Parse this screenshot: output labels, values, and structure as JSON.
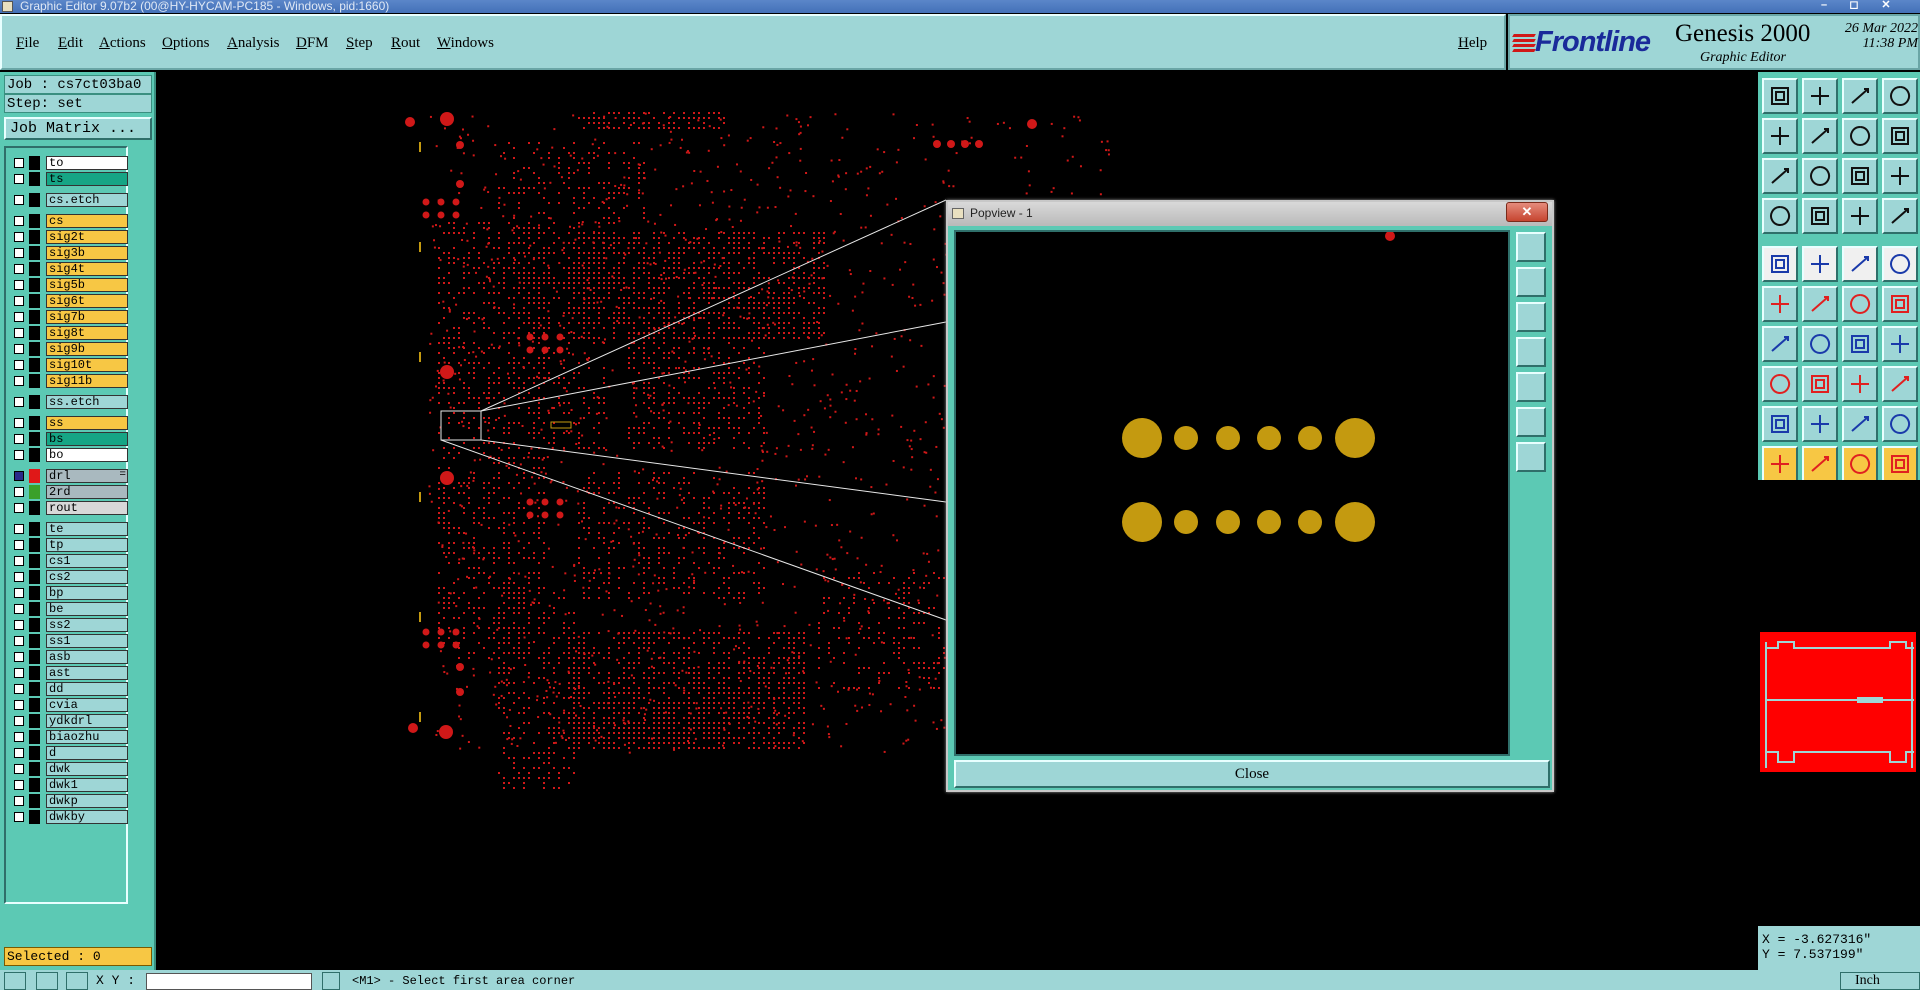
{
  "window": {
    "title": "Graphic Editor 9.07b2 (00@HY-HYCAM-PC185 - Windows, pid:1660)",
    "controls": [
      "–",
      "◻",
      "✕"
    ]
  },
  "menu": {
    "items": [
      "File",
      "Edit",
      "Actions",
      "Options",
      "Analysis",
      "DFM",
      "Step",
      "Rout",
      "Windows"
    ],
    "help": "Help"
  },
  "logo": {
    "brand": "Frontline",
    "product": "Genesis 2000",
    "subtitle": "Graphic Editor",
    "date": "26 Mar 2022",
    "time": "11:38 PM"
  },
  "job": {
    "job_label": "Job : cs7ct03ba0",
    "step_label": "Step: set",
    "job_matrix": "Job Matrix ..."
  },
  "layers": [
    {
      "name": "to",
      "color": "#ffffff",
      "swatch": "#000000"
    },
    {
      "name": "ts",
      "color": "#16a585",
      "swatch": "#000000"
    },
    {
      "name": "cs.etch",
      "color": "#9ed6d6",
      "swatch": "#000000",
      "gap": true
    },
    {
      "name": "cs",
      "color": "#f7c744",
      "swatch": "#000000",
      "gap": true
    },
    {
      "name": "sig2t",
      "color": "#f7c744",
      "swatch": "#000000"
    },
    {
      "name": "sig3b",
      "color": "#f7c744",
      "swatch": "#000000"
    },
    {
      "name": "sig4t",
      "color": "#f7c744",
      "swatch": "#000000"
    },
    {
      "name": "sig5b",
      "color": "#f7c744",
      "swatch": "#000000"
    },
    {
      "name": "sig6t",
      "color": "#f7c744",
      "swatch": "#000000"
    },
    {
      "name": "sig7b",
      "color": "#f7c744",
      "swatch": "#000000"
    },
    {
      "name": "sig8t",
      "color": "#f7c744",
      "swatch": "#000000"
    },
    {
      "name": "sig9b",
      "color": "#f7c744",
      "swatch": "#000000"
    },
    {
      "name": "sig10t",
      "color": "#f7c744",
      "swatch": "#000000"
    },
    {
      "name": "sig11b",
      "color": "#f7c744",
      "swatch": "#000000"
    },
    {
      "name": "ss.etch",
      "color": "#9ed6d6",
      "swatch": "#000000",
      "gap": true
    },
    {
      "name": "ss",
      "color": "#f7c744",
      "swatch": "#000000",
      "gap": true
    },
    {
      "name": "bs",
      "color": "#16a585",
      "swatch": "#000000"
    },
    {
      "name": "bo",
      "color": "#ffffff",
      "swatch": "#000000"
    },
    {
      "name": "drl",
      "color": "#a9b9bf",
      "swatch": "#e01818",
      "gap": true,
      "active": true,
      "marker": "="
    },
    {
      "name": "2rd",
      "color": "#a9b9bf",
      "swatch": "#3aa02a"
    },
    {
      "name": "rout",
      "color": "#d8d8d8",
      "swatch": "#000000"
    },
    {
      "name": "te",
      "color": "#9ed6d6",
      "swatch": "#000000",
      "gap": true
    },
    {
      "name": "tp",
      "color": "#9ed6d6",
      "swatch": "#000000"
    },
    {
      "name": "cs1",
      "color": "#9ed6d6",
      "swatch": "#000000"
    },
    {
      "name": "cs2",
      "color": "#9ed6d6",
      "swatch": "#000000"
    },
    {
      "name": "bp",
      "color": "#9ed6d6",
      "swatch": "#000000"
    },
    {
      "name": "be",
      "color": "#9ed6d6",
      "swatch": "#000000"
    },
    {
      "name": "ss2",
      "color": "#9ed6d6",
      "swatch": "#000000"
    },
    {
      "name": "ss1",
      "color": "#9ed6d6",
      "swatch": "#000000"
    },
    {
      "name": "asb",
      "color": "#9ed6d6",
      "swatch": "#000000"
    },
    {
      "name": "ast",
      "color": "#9ed6d6",
      "swatch": "#000000"
    },
    {
      "name": "dd",
      "color": "#9ed6d6",
      "swatch": "#000000"
    },
    {
      "name": "cvia",
      "color": "#9ed6d6",
      "swatch": "#000000"
    },
    {
      "name": "ydkdrl",
      "color": "#9ed6d6",
      "swatch": "#000000"
    },
    {
      "name": "biaozhu",
      "color": "#9ed6d6",
      "swatch": "#000000"
    },
    {
      "name": "d",
      "color": "#9ed6d6",
      "swatch": "#000000"
    },
    {
      "name": "dwk",
      "color": "#9ed6d6",
      "swatch": "#000000"
    },
    {
      "name": "dwk1",
      "color": "#9ed6d6",
      "swatch": "#000000"
    },
    {
      "name": "dwkp",
      "color": "#9ed6d6",
      "swatch": "#000000"
    },
    {
      "name": "dwkby",
      "color": "#9ed6d6",
      "swatch": "#000000"
    }
  ],
  "status": {
    "selected": "Selected : 0",
    "xy_label": "X Y :",
    "prompt": "<M1> - Select first area corner",
    "units": "Inch"
  },
  "coords": {
    "x": "X = -3.627316\"",
    "y": "Y = 7.537199\""
  },
  "popview": {
    "title": "Popview - 1",
    "close_x": "✕",
    "close_button": "Close"
  },
  "colors": {
    "feature_red": "#d01818",
    "pad_gold": "#c49a10",
    "panel_teal": "#5cc9b4",
    "button_cyan": "#9ed6d6"
  }
}
